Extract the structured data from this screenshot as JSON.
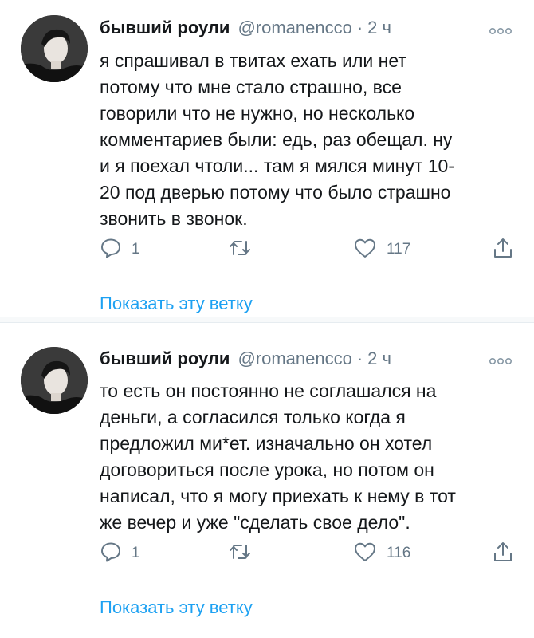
{
  "tweets": [
    {
      "author_name": "бывший роули",
      "handle": "@romanencco",
      "separator": "·",
      "time": "2 ч",
      "text_lines": [
        "я спрашивал в твитах ехать или нет",
        "потому что мне стало страшно, все",
        "говорили что не нужно, но несколько",
        "комментариев были: едь, раз обещал. ну",
        "и я поехал чтоли... там я мялся минут 10-",
        "20 под дверью потому что было страшно",
        "звонить в звонок."
      ],
      "reply_count": "1",
      "retweet_count": "",
      "like_count": "117",
      "show_thread": "Показать эту ветку"
    },
    {
      "author_name": "бывший роули",
      "handle": "@romanencco",
      "separator": "·",
      "time": "2 ч",
      "text_lines": [
        "то есть он постоянно не соглашался на",
        "деньги, а согласился только когда я",
        "предложил ми*ет. изначально он хотел",
        "договориться после урока, но потом он",
        "написал, что я могу приехать к нему в тот",
        "же вечер и уже \"сделать свое дело\"."
      ],
      "reply_count": "1",
      "retweet_count": "",
      "like_count": "116",
      "show_thread": "Показать эту ветку"
    }
  ],
  "icons": {
    "reply": "reply-icon",
    "retweet": "retweet-icon",
    "like": "heart-icon",
    "share": "share-icon",
    "more": "more-icon"
  },
  "colors": {
    "text": "#14171a",
    "secondary": "#657786",
    "link": "#1da1f2",
    "divider": "#e6ecf0"
  }
}
